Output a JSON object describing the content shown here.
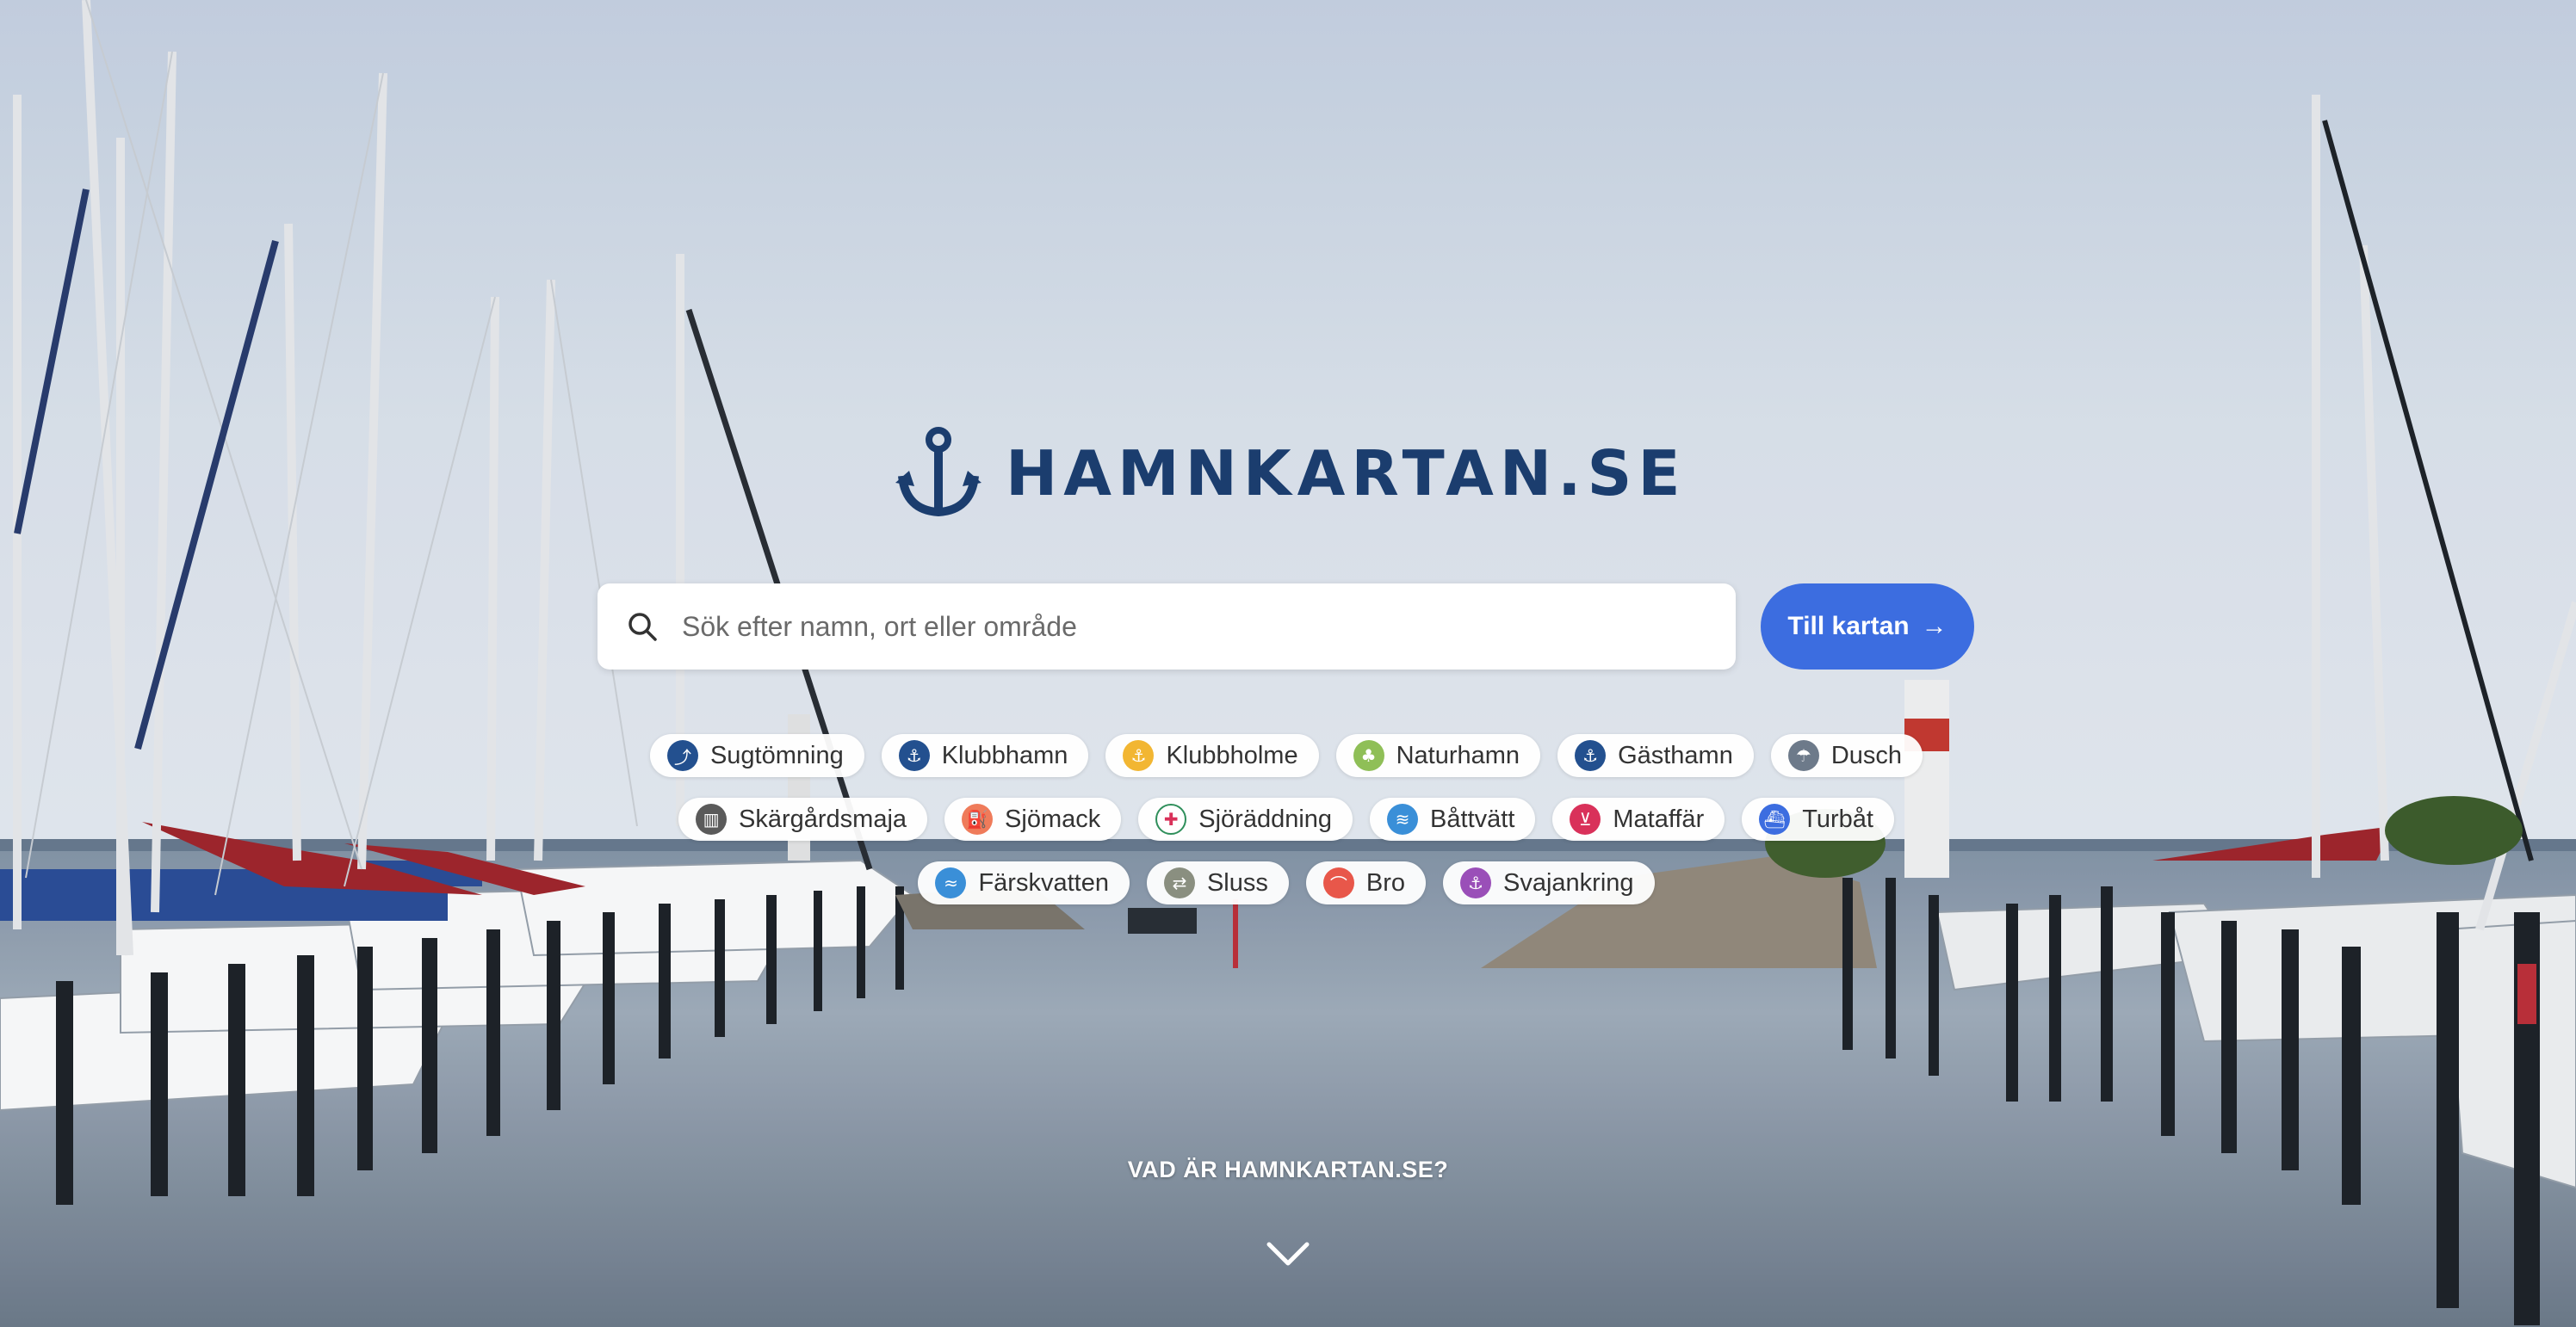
{
  "brand": {
    "name": "HAMNKARTAN.SE"
  },
  "search": {
    "placeholder": "Sök efter namn, ort eller område"
  },
  "cta": {
    "label": "Till kartan",
    "arrow": "→"
  },
  "filters": [
    [
      {
        "label": "Sugtömning",
        "icon": "pump-out-icon",
        "color": "#23508f",
        "glyph": "⤴"
      },
      {
        "label": "Klubbhamn",
        "icon": "anchor-icon",
        "color": "#23508f",
        "glyph": "⚓"
      },
      {
        "label": "Klubbholme",
        "icon": "anchor-icon",
        "color": "#f2b632",
        "glyph": "⚓"
      },
      {
        "label": "Naturhamn",
        "icon": "tree-icon",
        "color": "#8fbf57",
        "glyph": "♣"
      },
      {
        "label": "Gästhamn",
        "icon": "anchor-icon",
        "color": "#23508f",
        "glyph": "⚓"
      },
      {
        "label": "Dusch",
        "icon": "shower-icon",
        "color": "#6d7a8a",
        "glyph": "☂"
      }
    ],
    [
      {
        "label": "Skärgårdsmaja",
        "icon": "trash-icon",
        "color": "#5a5a5a",
        "glyph": "▥"
      },
      {
        "label": "Sjömack",
        "icon": "fuel-icon",
        "color": "#ef7b5a",
        "glyph": "⛽"
      },
      {
        "label": "Sjöräddning",
        "icon": "lifebuoy-icon",
        "color": "#ffffff",
        "glyph": "✚"
      },
      {
        "label": "Båttvätt",
        "icon": "boatwash-icon",
        "color": "#3a8fd8",
        "glyph": "≋"
      },
      {
        "label": "Mataffär",
        "icon": "cart-icon",
        "color": "#d9315a",
        "glyph": "⊻"
      },
      {
        "label": "Turbåt",
        "icon": "ferry-icon",
        "color": "#3c6de0",
        "glyph": "⛴"
      }
    ],
    [
      {
        "label": "Färskvatten",
        "icon": "water-icon",
        "color": "#3a8fd8",
        "glyph": "≈"
      },
      {
        "label": "Sluss",
        "icon": "lock-icon",
        "color": "#8a8f80",
        "glyph": "⇄"
      },
      {
        "label": "Bro",
        "icon": "bridge-icon",
        "color": "#e8574a",
        "glyph": "⌒"
      },
      {
        "label": "Svajankring",
        "icon": "anchor-icon",
        "color": "#9a4fb8",
        "glyph": "⚓"
      }
    ]
  ],
  "about": {
    "label": "VAD ÄR HAMNKARTAN.SE?"
  },
  "colors": {
    "brand": "#1b3d6e",
    "accent": "#3c6de0"
  }
}
